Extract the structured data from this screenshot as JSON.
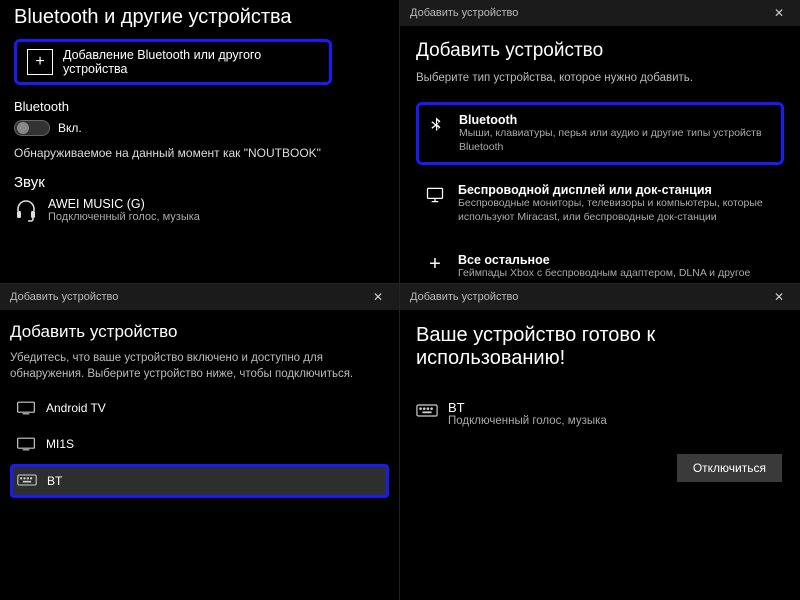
{
  "q1": {
    "page_title": "Bluetooth и другие устройства",
    "add_button": "Добавление Bluetooth или другого устройства",
    "bluetooth_label": "Bluetooth",
    "toggle_state": "Вкл.",
    "discoverable": "Обнаруживаемое на данный момент как \"NOUTBOOK\"",
    "sound_header": "Звук",
    "audio_device": {
      "name": "AWEI MUSIC (G)",
      "status": "Подключенный голос, музыка"
    }
  },
  "q2": {
    "header": "Добавить устройство",
    "title": "Добавить устройство",
    "subtitle": "Выберите тип устройства, которое нужно добавить.",
    "options": [
      {
        "title": "Bluetooth",
        "desc": "Мыши, клавиатуры, перья или аудио и другие типы устройств Bluetooth"
      },
      {
        "title": "Беспроводной дисплей или док-станция",
        "desc": "Беспроводные мониторы, телевизоры и компьютеры, которые используют Miracast, или беспроводные док-станции"
      },
      {
        "title": "Все остальное",
        "desc": "Геймпады Xbox с беспроводным адаптером, DLNA и другое"
      }
    ]
  },
  "q3": {
    "header": "Добавить устройство",
    "title": "Добавить устройство",
    "subtitle": "Убедитесь, что ваше устройство включено и доступно для обнаружения. Выберите устройство ниже, чтобы подключиться.",
    "devices": [
      {
        "name": "Android TV"
      },
      {
        "name": "MI1S"
      },
      {
        "name": "BT"
      }
    ]
  },
  "q4": {
    "header": "Добавить устройство",
    "title": "Ваше устройство готово к использованию!",
    "device": {
      "name": "BT",
      "status": "Подключенный голос, музыка"
    },
    "disconnect": "Отключиться"
  }
}
